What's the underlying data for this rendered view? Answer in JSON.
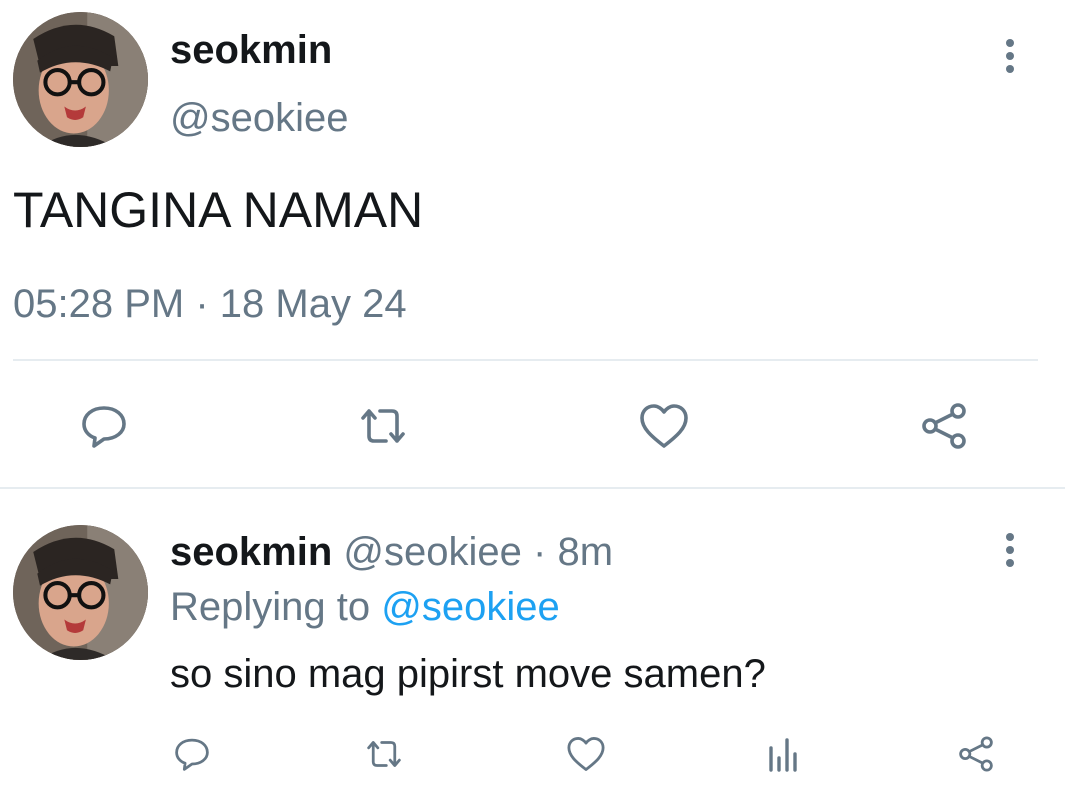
{
  "main_tweet": {
    "display_name": "seokmin",
    "handle": "@seokiee",
    "text": "TANGINA NAMAN",
    "time": "05:28 PM",
    "separator": "·",
    "date": "18 May 24",
    "more_icon": "more-vertical-icon",
    "actions": {
      "reply_icon": "reply-icon",
      "retweet_icon": "retweet-icon",
      "like_icon": "heart-icon",
      "share_icon": "share-icon"
    }
  },
  "reply_tweet": {
    "display_name": "seokmin",
    "handle": "@seokiee",
    "separator": "·",
    "relative_time": "8m",
    "replying_to_label": "Replying to",
    "replying_to_handle": "@seokiee",
    "text": "so sino mag pipirst move samen?",
    "more_icon": "more-vertical-icon",
    "actions": {
      "reply_icon": "reply-icon",
      "retweet_icon": "retweet-icon",
      "like_icon": "heart-icon",
      "stats_icon": "stats-icon",
      "share_icon": "share-icon"
    }
  },
  "colors": {
    "text_primary": "#14171a",
    "text_secondary": "#657786",
    "link": "#1da1f2",
    "divider": "#e6ecf0",
    "icon": "#657786"
  }
}
